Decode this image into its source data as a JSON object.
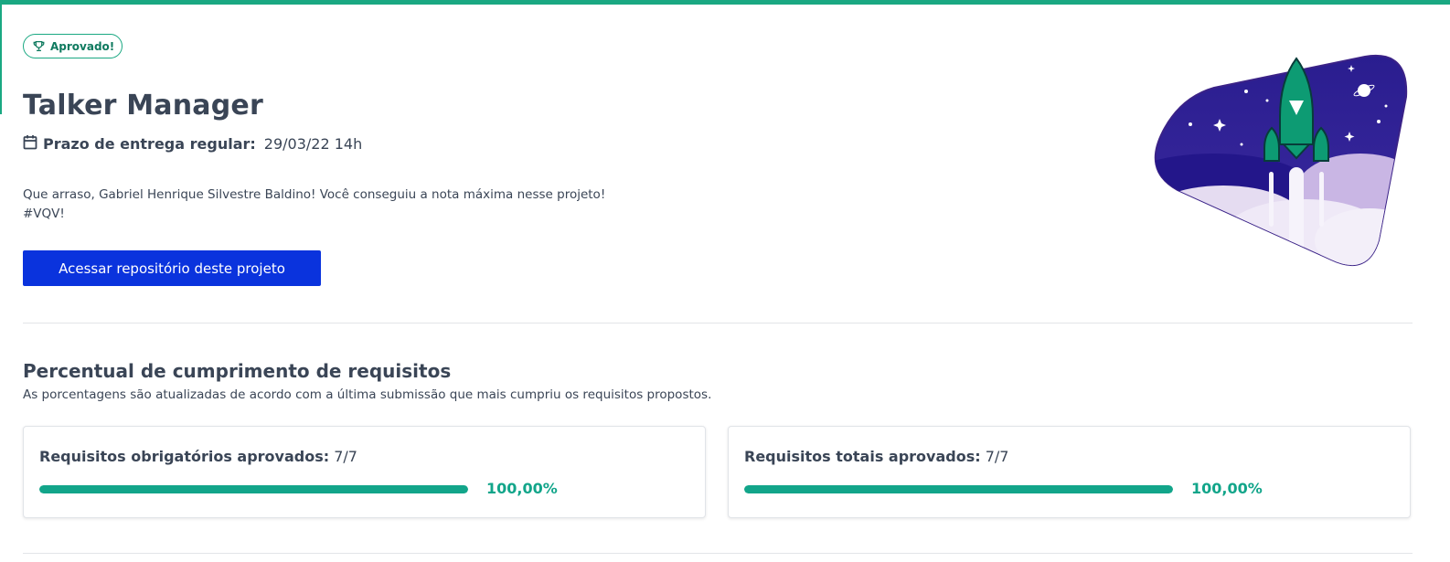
{
  "header": {
    "badge_label": "Aprovado!",
    "badge_icon": "trophy-icon",
    "title": "Talker Manager",
    "deadline_label": "Prazo de entrega regular:",
    "deadline_value": "29/03/22 14h",
    "deadline_icon": "calendar-icon",
    "message_line1": "Que arraso, Gabriel Henrique Silvestre Baldino! Você conseguiu a nota máxima nesse projeto!",
    "message_line2": "#VQV!",
    "repo_button_label": "Acessar repositório deste projeto",
    "illustration_icon": "rocket-illustration"
  },
  "requirements": {
    "title": "Percentual de cumprimento de requisitos",
    "subtitle": "As porcentagens são atualizadas de acordo com a última submissão que mais cumpriu os requisitos propostos.",
    "cards": [
      {
        "label": "Requisitos obrigatórios aprovados:",
        "count": "7/7",
        "percent_text": "100,00%",
        "progress": 1.0
      },
      {
        "label": "Requisitos totais aprovados:",
        "count": "7/7",
        "percent_text": "100,00%",
        "progress": 1.0
      }
    ]
  },
  "colors": {
    "accent_green": "#1aa882",
    "progress_green": "#12a58a",
    "button_blue": "#0a33dd",
    "text_dark": "#3a4556"
  }
}
